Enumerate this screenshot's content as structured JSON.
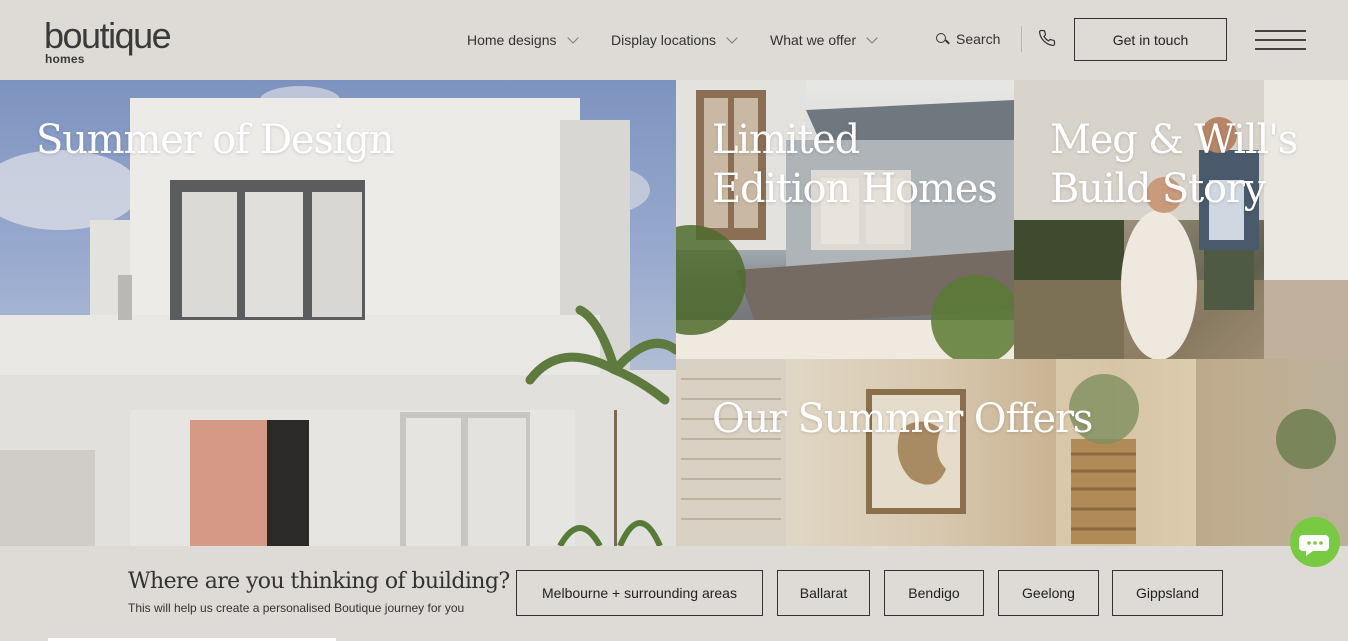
{
  "header": {
    "logo": {
      "main": "boutique",
      "sub": "homes"
    },
    "nav": [
      {
        "label": "Home designs"
      },
      {
        "label": "Display locations"
      },
      {
        "label": "What we offer"
      }
    ],
    "search_label": "Search",
    "cta_label": "Get in touch"
  },
  "tiles": [
    {
      "title": "Summer of Design"
    },
    {
      "title_line1": "Limited",
      "title_line2": "Edition Homes"
    },
    {
      "title_line1": "Meg & Will's",
      "title_line2": "Build Story"
    },
    {
      "title": "Our Summer Offers"
    }
  ],
  "location_prompt": {
    "title": "Where are you thinking of building?",
    "subtitle": "This will help us create a personalised Boutique journey for you",
    "options": [
      "Melbourne + surrounding areas",
      "Ballarat",
      "Bendigo",
      "Geelong",
      "Gippsland"
    ]
  },
  "colors": {
    "background": "#dedad6",
    "text": "#2b2b2b",
    "chat": "#7ac943"
  }
}
